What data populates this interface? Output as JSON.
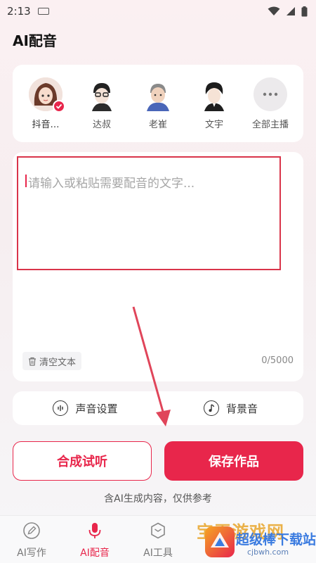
{
  "status": {
    "time": "2:13"
  },
  "header": {
    "title": "AI配音"
  },
  "voices": [
    {
      "label": "抖音…",
      "selected": true
    },
    {
      "label": "达叔"
    },
    {
      "label": "老崔"
    },
    {
      "label": "文宇"
    },
    {
      "label": "全部主播"
    }
  ],
  "editor": {
    "placeholder": "请输入或粘贴需要配音的文字...",
    "clear_label": "清空文本",
    "counter": "0/5000"
  },
  "settings": {
    "voice_settings_label": "声音设置",
    "bgm_label": "背景音"
  },
  "actions": {
    "preview_label": "合成试听",
    "save_label": "保存作品"
  },
  "disclaimer": "含AI生成内容，仅供参考",
  "tabs": [
    {
      "label": "AI写作",
      "active": false
    },
    {
      "label": "AI配音",
      "active": true
    },
    {
      "label": "AI工具",
      "active": false
    }
  ],
  "watermark": {
    "line1": "宝玉游戏网",
    "line2": "超级棒下载站",
    "url": "cjbwh.com"
  },
  "colors": {
    "accent": "#e8264b",
    "annotation_red": "#d9344a"
  }
}
